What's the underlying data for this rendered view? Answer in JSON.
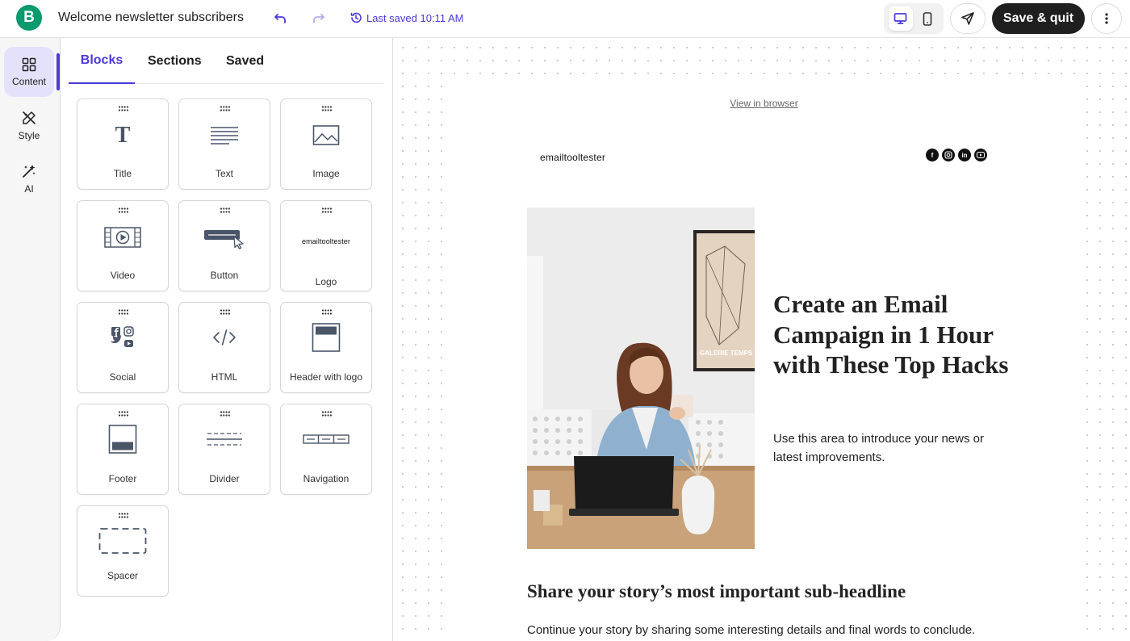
{
  "app": {
    "brand_letter": "B"
  },
  "header": {
    "title": "Welcome newsletter subscribers",
    "last_saved": "Last saved 10:11 AM",
    "save_quit_label": "Save & quit"
  },
  "rail": {
    "items": [
      {
        "label": "Content",
        "icon": "grid-icon",
        "active": true
      },
      {
        "label": "Style",
        "icon": "brush-icon",
        "active": false
      },
      {
        "label": "AI",
        "icon": "magic-wand-icon",
        "active": false
      }
    ]
  },
  "panel": {
    "tabs": [
      {
        "label": "Blocks",
        "active": true
      },
      {
        "label": "Sections",
        "active": false
      },
      {
        "label": "Saved",
        "active": false
      }
    ],
    "blocks": [
      {
        "label": "Title",
        "icon": "title-icon"
      },
      {
        "label": "Text",
        "icon": "text-icon"
      },
      {
        "label": "Image",
        "icon": "image-icon"
      },
      {
        "label": "Video",
        "icon": "video-icon"
      },
      {
        "label": "Button",
        "icon": "button-icon"
      },
      {
        "label": "Logo",
        "icon": "logo-icon",
        "logo_text": "emailtooltester"
      },
      {
        "label": "Social",
        "icon": "social-icon"
      },
      {
        "label": "HTML",
        "icon": "html-icon"
      },
      {
        "label": "Header with logo",
        "icon": "header-with-logo-icon"
      },
      {
        "label": "Footer",
        "icon": "footer-icon"
      },
      {
        "label": "Divider",
        "icon": "divider-icon"
      },
      {
        "label": "Navigation",
        "icon": "navigation-icon"
      },
      {
        "label": "Spacer",
        "icon": "spacer-icon"
      }
    ]
  },
  "email": {
    "view_in_browser": "View in browser",
    "logo_text": "emailtooltester",
    "headline": "Create an Email Campaign in 1 Hour with These Top Hacks",
    "intro": "Use this area to introduce your news or latest improvements.",
    "subheadline": "Share your story’s most important sub-headline",
    "body": "Continue your story by sharing some interesting details and final words to conclude.",
    "hero_poster_text": "GALERIE TEMPS"
  },
  "colors": {
    "accent": "#4a3ad8",
    "brand_green": "#0b996e",
    "dark_button": "#1f1f1f",
    "rail_active": "#e4e1fa"
  }
}
